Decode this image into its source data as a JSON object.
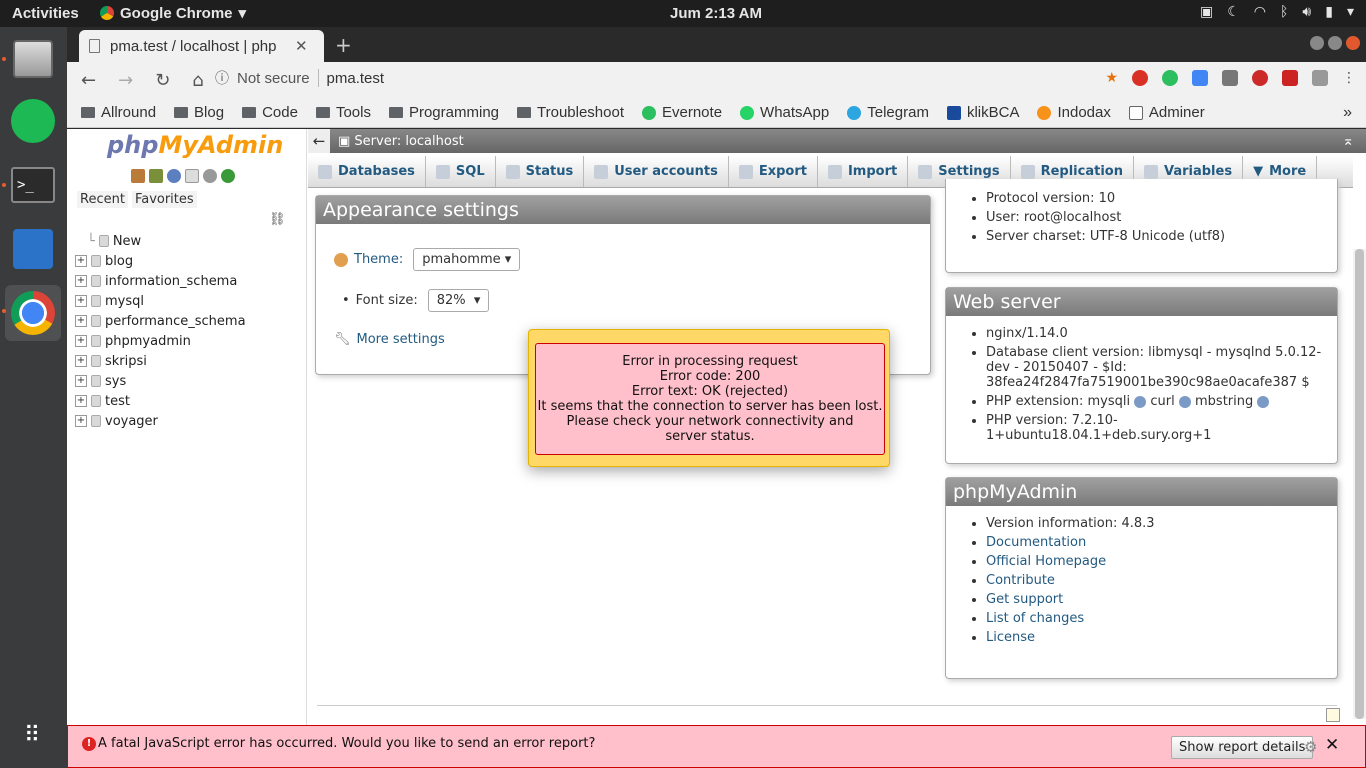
{
  "os": {
    "activities": "Activities",
    "app_name": "Google Chrome",
    "clock": "Jum  2:13 AM"
  },
  "browser": {
    "tab_title": "pma.test / localhost | php",
    "not_secure": "Not secure",
    "url": "pma.test",
    "bookmarks": [
      "Allround",
      "Blog",
      "Code",
      "Tools",
      "Programming",
      "Troubleshoot",
      "Evernote",
      "WhatsApp",
      "Telegram",
      "klikBCA",
      "Indodax",
      "Adminer"
    ],
    "more": "»"
  },
  "pma": {
    "logo_php": "php",
    "logo_myadmin": "MyAdmin",
    "recent": "Recent",
    "favorites": "Favorites",
    "databases": [
      "New",
      "blog",
      "information_schema",
      "mysql",
      "performance_schema",
      "phpmyadmin",
      "skripsi",
      "sys",
      "test",
      "voyager"
    ],
    "server_label": "Server: localhost",
    "menu": [
      "Databases",
      "SQL",
      "Status",
      "User accounts",
      "Export",
      "Import",
      "Settings",
      "Replication",
      "Variables",
      "More"
    ]
  },
  "appearance": {
    "title": "Appearance settings",
    "theme_label": "Theme:",
    "theme_value": "pmahomme",
    "font_label": "Font size:",
    "font_value": "82%",
    "more_settings": "More settings"
  },
  "dbserver": {
    "items": [
      "Protocol version: 10",
      "User: root@localhost",
      "Server charset: UTF-8 Unicode (utf8)"
    ]
  },
  "webserver": {
    "title": "Web server",
    "nginx": "nginx/1.14.0",
    "dbclient": "Database client version: libmysql - mysqlnd 5.0.12-dev - 20150407 - $Id: 38fea24f2847fa7519001be390c98ae0acafe387 $",
    "php_ext_label": "PHP extension: mysqli",
    "php_ext_curl": "curl",
    "php_ext_mb": "mbstring",
    "php_version": "PHP version: 7.2.10-1+ubuntu18.04.1+deb.sury.org+1"
  },
  "pmapanel": {
    "title": "phpMyAdmin",
    "version": "Version information: 4.8.3",
    "links": [
      "Documentation",
      "Official Homepage",
      "Contribute",
      "Get support",
      "List of changes",
      "License"
    ]
  },
  "error": {
    "lines": [
      "Error in processing request",
      "Error code: 200",
      "Error text: OK (rejected)",
      "It seems that the connection to server has been lost.",
      "Please check your network connectivity and server status."
    ]
  },
  "fatal": {
    "message": "A fatal JavaScript error has occurred. Would you like to send an error report?",
    "button": "Show report details"
  }
}
